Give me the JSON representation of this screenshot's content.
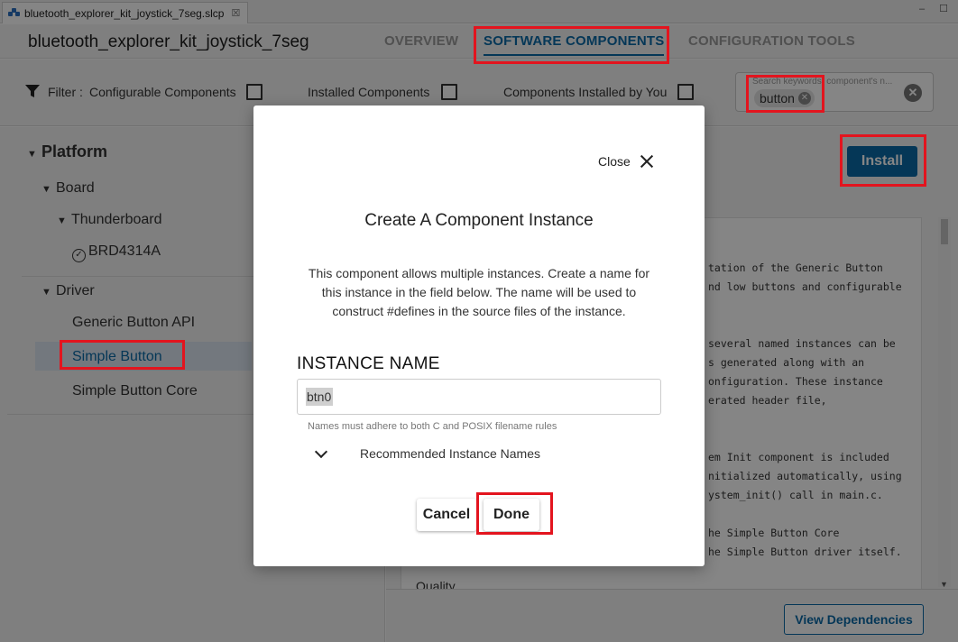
{
  "editor_tab": {
    "label": "bluetooth_explorer_kit_joystick_7seg.slcp",
    "close": "☒"
  },
  "window_controls": {
    "minimize": "–",
    "maximize": "☐"
  },
  "header": {
    "project_title": "bluetooth_explorer_kit_joystick_7seg",
    "tabs": [
      {
        "label": "OVERVIEW",
        "active": false
      },
      {
        "label": "SOFTWARE COMPONENTS",
        "active": true
      },
      {
        "label": "CONFIGURATION TOOLS",
        "active": false
      }
    ]
  },
  "filter": {
    "label": "Filter :",
    "configurable": "Configurable Components",
    "installed": "Installed Components",
    "installed_by_you": "Components Installed by You",
    "search_placeholder": "Search keywords, component's n...",
    "search_chip": "button"
  },
  "tree": {
    "platform": "Platform",
    "board": "Board",
    "thunderboard": "Thunderboard",
    "brd": "BRD4314A",
    "driver": "Driver",
    "generic_button_api": "Generic Button API",
    "simple_button": "Simple Button",
    "simple_button_core": "Simple Button Core"
  },
  "content": {
    "install_label": "Install",
    "doc_lines": [
      "tation of the Generic Button",
      "nd low buttons and configurable",
      "several named instances can be",
      "s generated along with an",
      "onfiguration. These instance",
      "erated header file,",
      "em Init component is included",
      "nitialized automatically, using",
      "ystem_init() call in main.c.",
      "he Simple Button Core",
      "he Simple Button driver itself."
    ],
    "quality": "Quality",
    "view_dependencies": "View Dependencies"
  },
  "modal": {
    "close_label": "Close",
    "title": "Create A Component Instance",
    "description": "This component allows multiple instances. Create a name for this instance in the field below. The name will be used to construct #defines in the source files of the instance.",
    "field_label": "INSTANCE NAME",
    "instance_value": "btn0",
    "field_hint": "Names must adhere to both C and POSIX filename rules",
    "recommended": "Recommended Instance Names",
    "cancel_label": "Cancel",
    "done_label": "Done"
  },
  "colors": {
    "accent": "#0a6aa8",
    "highlight": "#e3141e"
  },
  "icons": {
    "tab_icon": "project-icon",
    "filter_icon": "funnel-icon",
    "chip_close": "close-icon",
    "search_clear": "clear-icon",
    "tree_arrow": "triangle-down-icon",
    "check_circle": "check-circle-icon",
    "modal_close": "close-icon",
    "chevron": "chevron-down-icon"
  }
}
